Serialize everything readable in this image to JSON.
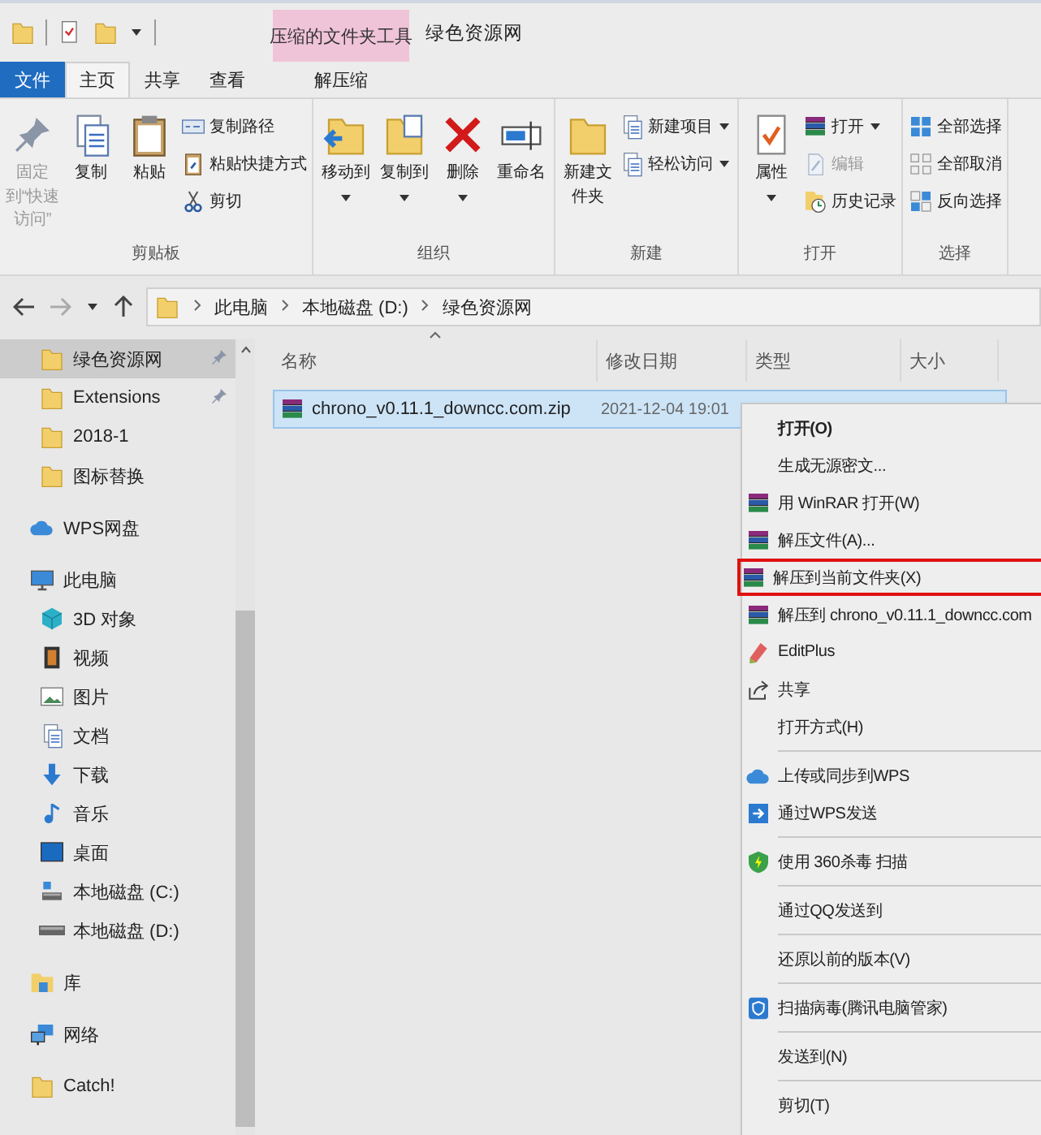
{
  "window": {
    "title": "绿色资源网"
  },
  "contextual_tab": {
    "group": "压缩的文件夹工具",
    "tab": {
      "label": "解压缩",
      "selected": false
    }
  },
  "tabs": [
    {
      "label": "文件",
      "kind": "file",
      "selected": false
    },
    {
      "label": "主页",
      "kind": "normal",
      "selected": true
    },
    {
      "label": "共享",
      "kind": "normal",
      "selected": false
    },
    {
      "label": "查看",
      "kind": "normal",
      "selected": false
    }
  ],
  "ribbon": [
    {
      "label": "剪贴板",
      "columns": [
        {
          "kind": "large",
          "buttons": [
            {
              "label": "固定到“快速访问”",
              "kind": "pin",
              "disabled": true,
              "dropdown": false
            }
          ]
        },
        {
          "kind": "large",
          "buttons": [
            {
              "label": "复制",
              "kind": "copy",
              "disabled": false,
              "dropdown": false
            }
          ]
        },
        {
          "kind": "large",
          "buttons": [
            {
              "label": "粘贴",
              "kind": "paste",
              "disabled": false,
              "dropdown": false
            }
          ]
        },
        {
          "kind": "small",
          "buttons": [
            {
              "label": "复制路径",
              "kind": "path",
              "disabled": false,
              "dropdown": false
            },
            {
              "label": "粘贴快捷方式",
              "kind": "shortcut",
              "disabled": false,
              "dropdown": false
            },
            {
              "label": "剪切",
              "kind": "cut",
              "disabled": false,
              "dropdown": false
            }
          ]
        }
      ]
    },
    {
      "label": "组织",
      "columns": [
        {
          "kind": "large",
          "buttons": [
            {
              "label": "移动到",
              "kind": "move",
              "disabled": false,
              "dropdown": true
            }
          ]
        },
        {
          "kind": "large",
          "buttons": [
            {
              "label": "复制到",
              "kind": "copyto",
              "disabled": false,
              "dropdown": true
            }
          ]
        },
        {
          "kind": "large",
          "buttons": [
            {
              "label": "删除",
              "kind": "delete",
              "disabled": false,
              "dropdown": true
            }
          ]
        },
        {
          "kind": "large",
          "buttons": [
            {
              "label": "重命名",
              "kind": "rename",
              "disabled": false,
              "dropdown": false
            }
          ]
        }
      ]
    },
    {
      "label": "新建",
      "columns": [
        {
          "kind": "large",
          "buttons": [
            {
              "label": "新建文件夹",
              "kind": "folder",
              "disabled": false,
              "dropdown": false
            }
          ]
        },
        {
          "kind": "small",
          "buttons": [
            {
              "label": "新建项目",
              "kind": "newitem",
              "disabled": false,
              "dropdown": true
            },
            {
              "label": "轻松访问",
              "kind": "easy",
              "disabled": false,
              "dropdown": true
            }
          ]
        }
      ]
    },
    {
      "label": "打开",
      "columns": [
        {
          "kind": "large",
          "buttons": [
            {
              "label": "属性",
              "kind": "props",
              "disabled": false,
              "dropdown": true
            }
          ]
        },
        {
          "kind": "small",
          "buttons": [
            {
              "label": "打开",
              "kind": "archive",
              "disabled": false,
              "dropdown": true
            },
            {
              "label": "编辑",
              "kind": "edit",
              "disabled": true,
              "dropdown": false
            },
            {
              "label": "历史记录",
              "kind": "history",
              "disabled": false,
              "dropdown": false
            }
          ]
        }
      ]
    },
    {
      "label": "选择",
      "columns": [
        {
          "kind": "small",
          "buttons": [
            {
              "label": "全部选择",
              "kind": "selall",
              "disabled": false,
              "dropdown": false
            },
            {
              "label": "全部取消",
              "kind": "selnone",
              "disabled": false,
              "dropdown": false
            },
            {
              "label": "反向选择",
              "kind": "selinv",
              "disabled": false,
              "dropdown": false
            }
          ]
        }
      ]
    }
  ],
  "address": {
    "back_disabled": false,
    "forward_disabled": true,
    "path": [
      "此电脑",
      "本地磁盘 (D:)",
      "绿色资源网"
    ]
  },
  "sidebar": {
    "pinned": [
      {
        "label": "绿色资源网",
        "pinned": true,
        "selected": true
      },
      {
        "label": "Extensions",
        "pinned": true,
        "selected": false
      },
      {
        "label": "2018-1",
        "pinned": false,
        "selected": false
      },
      {
        "label": "图标替换",
        "pinned": false,
        "selected": false
      }
    ],
    "tree": [
      {
        "label": "WPS网盘",
        "kind": "cloud"
      },
      {
        "label": "此电脑",
        "kind": "pc",
        "children": [
          {
            "label": "3D 对象",
            "kind": "cube"
          },
          {
            "label": "视频",
            "kind": "video"
          },
          {
            "label": "图片",
            "kind": "picture"
          },
          {
            "label": "文档",
            "kind": "document"
          },
          {
            "label": "下载",
            "kind": "download"
          },
          {
            "label": "音乐",
            "kind": "music"
          },
          {
            "label": "桌面",
            "kind": "desktop"
          },
          {
            "label": "本地磁盘 (C:)",
            "kind": "sysdrive"
          },
          {
            "label": "本地磁盘 (D:)",
            "kind": "drive"
          }
        ]
      },
      {
        "label": "库",
        "kind": "library"
      },
      {
        "label": "网络",
        "kind": "network"
      },
      {
        "label": "Catch!",
        "kind": "folder"
      }
    ]
  },
  "columns": [
    {
      "label": "名称",
      "sorted": true
    },
    {
      "label": "修改日期",
      "sorted": false
    },
    {
      "label": "类型",
      "sorted": false
    },
    {
      "label": "大小",
      "sorted": false
    }
  ],
  "files": [
    {
      "name": "chrono_v0.11.1_downcc.com.zip",
      "modified": "2021-12-04 19:01",
      "selected": true
    }
  ],
  "context_menu": [
    [
      {
        "label": "打开(O)",
        "kind": "default",
        "highlighted": false
      },
      {
        "label": "生成无源密文...",
        "kind": "plain",
        "highlighted": false
      },
      {
        "label": "用 WinRAR 打开(W)",
        "kind": "archive",
        "highlighted": false
      },
      {
        "label": "解压文件(A)...",
        "kind": "archive",
        "highlighted": false
      },
      {
        "label": "解压到当前文件夹(X)",
        "kind": "archive",
        "highlighted": true
      },
      {
        "label": "解压到 chrono_v0.11.1_downcc.com",
        "kind": "archive",
        "highlighted": false
      },
      {
        "label": "EditPlus",
        "kind": "editor",
        "highlighted": false
      },
      {
        "label": "共享",
        "kind": "share",
        "highlighted": false
      },
      {
        "label": "打开方式(H)",
        "kind": "plain",
        "highlighted": false
      }
    ],
    [
      {
        "label": "上传或同步到WPS",
        "kind": "cloud",
        "highlighted": false
      },
      {
        "label": "通过WPS发送",
        "kind": "send",
        "highlighted": false
      }
    ],
    [
      {
        "label": "使用 360杀毒 扫描",
        "kind": "shield",
        "highlighted": false
      }
    ],
    [
      {
        "label": "通过QQ发送到",
        "kind": "plain",
        "highlighted": false
      }
    ],
    [
      {
        "label": "还原以前的版本(V)",
        "kind": "plain",
        "highlighted": false
      }
    ],
    [
      {
        "label": "扫描病毒(腾讯电脑管家)",
        "kind": "guard",
        "highlighted": false
      }
    ],
    [
      {
        "label": "发送到(N)",
        "kind": "plain",
        "highlighted": false
      }
    ],
    [
      {
        "label": "剪切(T)",
        "kind": "plain",
        "highlighted": false
      }
    ]
  ]
}
